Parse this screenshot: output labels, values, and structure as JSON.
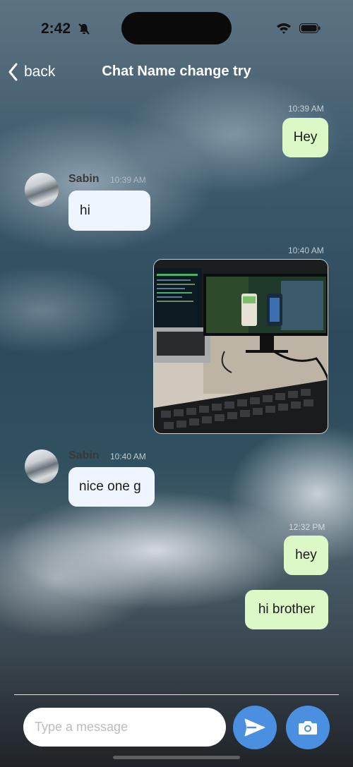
{
  "status_bar": {
    "time": "2:42"
  },
  "nav": {
    "back_label": "back",
    "title": "Chat Name change try"
  },
  "messages": [
    {
      "type": "outgoing",
      "time": "10:39 AM",
      "text": "Hey"
    },
    {
      "type": "incoming",
      "sender": "Sabin",
      "time": "10:39 AM",
      "text": "hi"
    },
    {
      "type": "outgoing-image",
      "time": "10:40 AM"
    },
    {
      "type": "incoming",
      "sender": "Sabin",
      "time": "10:40 AM",
      "text": "nice one g"
    },
    {
      "type": "outgoing",
      "time": "12:32 PM",
      "text": "hey"
    },
    {
      "type": "outgoing",
      "time": "",
      "text": "hi brother"
    }
  ],
  "composer": {
    "placeholder": "Type a message"
  },
  "colors": {
    "outgoing_bubble": "#dcf8c6",
    "incoming_bubble": "#eef5ff",
    "action_button": "#4a8fe0"
  },
  "icons": [
    "bell-slash-icon",
    "wifi-icon",
    "battery-icon",
    "chevron-left-icon",
    "send-icon",
    "camera-icon"
  ]
}
